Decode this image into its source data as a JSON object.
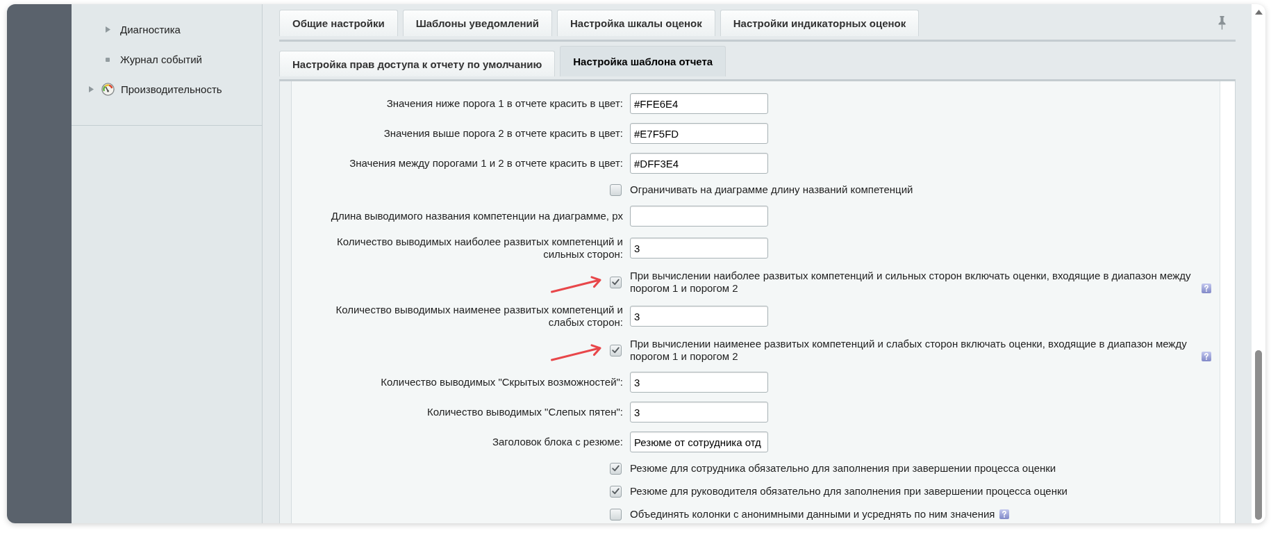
{
  "sidebar": {
    "sub_items": [
      {
        "label": "Диагностика",
        "kind": "expandable"
      },
      {
        "label": "Журнал событий",
        "kind": "page"
      }
    ],
    "items": [
      {
        "label": "Производительность",
        "kind": "expandable"
      }
    ]
  },
  "tab_rows": [
    {
      "tabs": [
        {
          "label": "Общие настройки",
          "selected": false
        },
        {
          "label": "Шаблоны уведомлений",
          "selected": false
        },
        {
          "label": "Настройка шкалы оценок",
          "selected": false
        },
        {
          "label": "Настройки индикаторных оценок",
          "selected": false
        }
      ]
    },
    {
      "tabs": [
        {
          "label": "Настройка прав доступа к отчету по умолчанию",
          "selected": false
        },
        {
          "label": "Настройка шаблона отчета",
          "selected": true
        }
      ]
    }
  ],
  "form": {
    "rows": [
      {
        "kind": "input",
        "label": "Значения ниже порога 1 в отчете красить в цвет:",
        "value": "#FFE6E4"
      },
      {
        "kind": "input",
        "label": "Значения выше порога 2 в отчете красить в цвет:",
        "value": "#E7F5FD"
      },
      {
        "kind": "input",
        "label": "Значения между порогами 1 и 2 в отчете красить в цвет:",
        "value": "#DFF3E4"
      },
      {
        "kind": "checkbox",
        "label": "Ограничивать на диаграмме длину названий компетенций",
        "checked": false,
        "help": false,
        "annotated": false
      },
      {
        "kind": "input",
        "label": "Длина выводимого названия компетенции на диаграмме, px"
      },
      {
        "kind": "input",
        "label": "Количество выводимых наиболее развитых компетенций и сильных сторон:",
        "value": "3"
      },
      {
        "kind": "checkbox",
        "label": "При вычислении наиболее развитых компетенций и сильных сторон включать оценки, входящие в диапазон между порогом 1 и порогом 2",
        "checked": true,
        "help": true,
        "annotated": true
      },
      {
        "kind": "input",
        "label": "Количество выводимых наименее развитых компетенций и слабых сторон:",
        "value": "3"
      },
      {
        "kind": "checkbox",
        "label": "При вычислении наименее развитых компетенций и слабых сторон включать оценки, входящие в диапазон между порогом 1 и порогом 2",
        "checked": true,
        "help": true,
        "annotated": true
      },
      {
        "kind": "input",
        "label": "Количество выводимых \"Скрытых возможностей\":",
        "value": "3"
      },
      {
        "kind": "input",
        "label": "Количество выводимых \"Слепых пятен\":",
        "value": "3"
      },
      {
        "kind": "input",
        "label": "Заголовок блока с резюме:",
        "value": "Резюме от сотрудника отд"
      },
      {
        "kind": "checkbox",
        "label": "Резюме для сотрудника обязательно для заполнения при завершении процесса оценки",
        "checked": true,
        "help": false,
        "annotated": false
      },
      {
        "kind": "checkbox",
        "label": "Резюме для руководителя обязательно для заполнения при завершении процесса оценки",
        "checked": true,
        "help": false,
        "annotated": false
      },
      {
        "kind": "checkbox",
        "label": "Объединять колонки с анонимными данными и усреднять по ним значения",
        "checked": false,
        "help": true,
        "annotated": false
      }
    ]
  }
}
